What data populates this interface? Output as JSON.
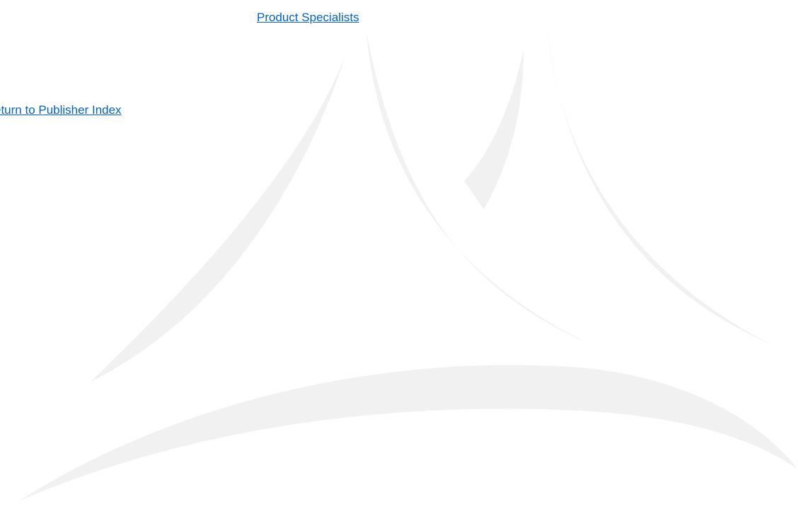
{
  "links": {
    "product_specialists": "Product Specialists",
    "return_to_publisher_index": "eturn to Publisher Index"
  },
  "colors": {
    "link": "#0563c1",
    "watermark": "#f1f1f1",
    "background": "#ffffff"
  },
  "watermark": {
    "icon": "mountain-peaks-logo-watermark"
  }
}
